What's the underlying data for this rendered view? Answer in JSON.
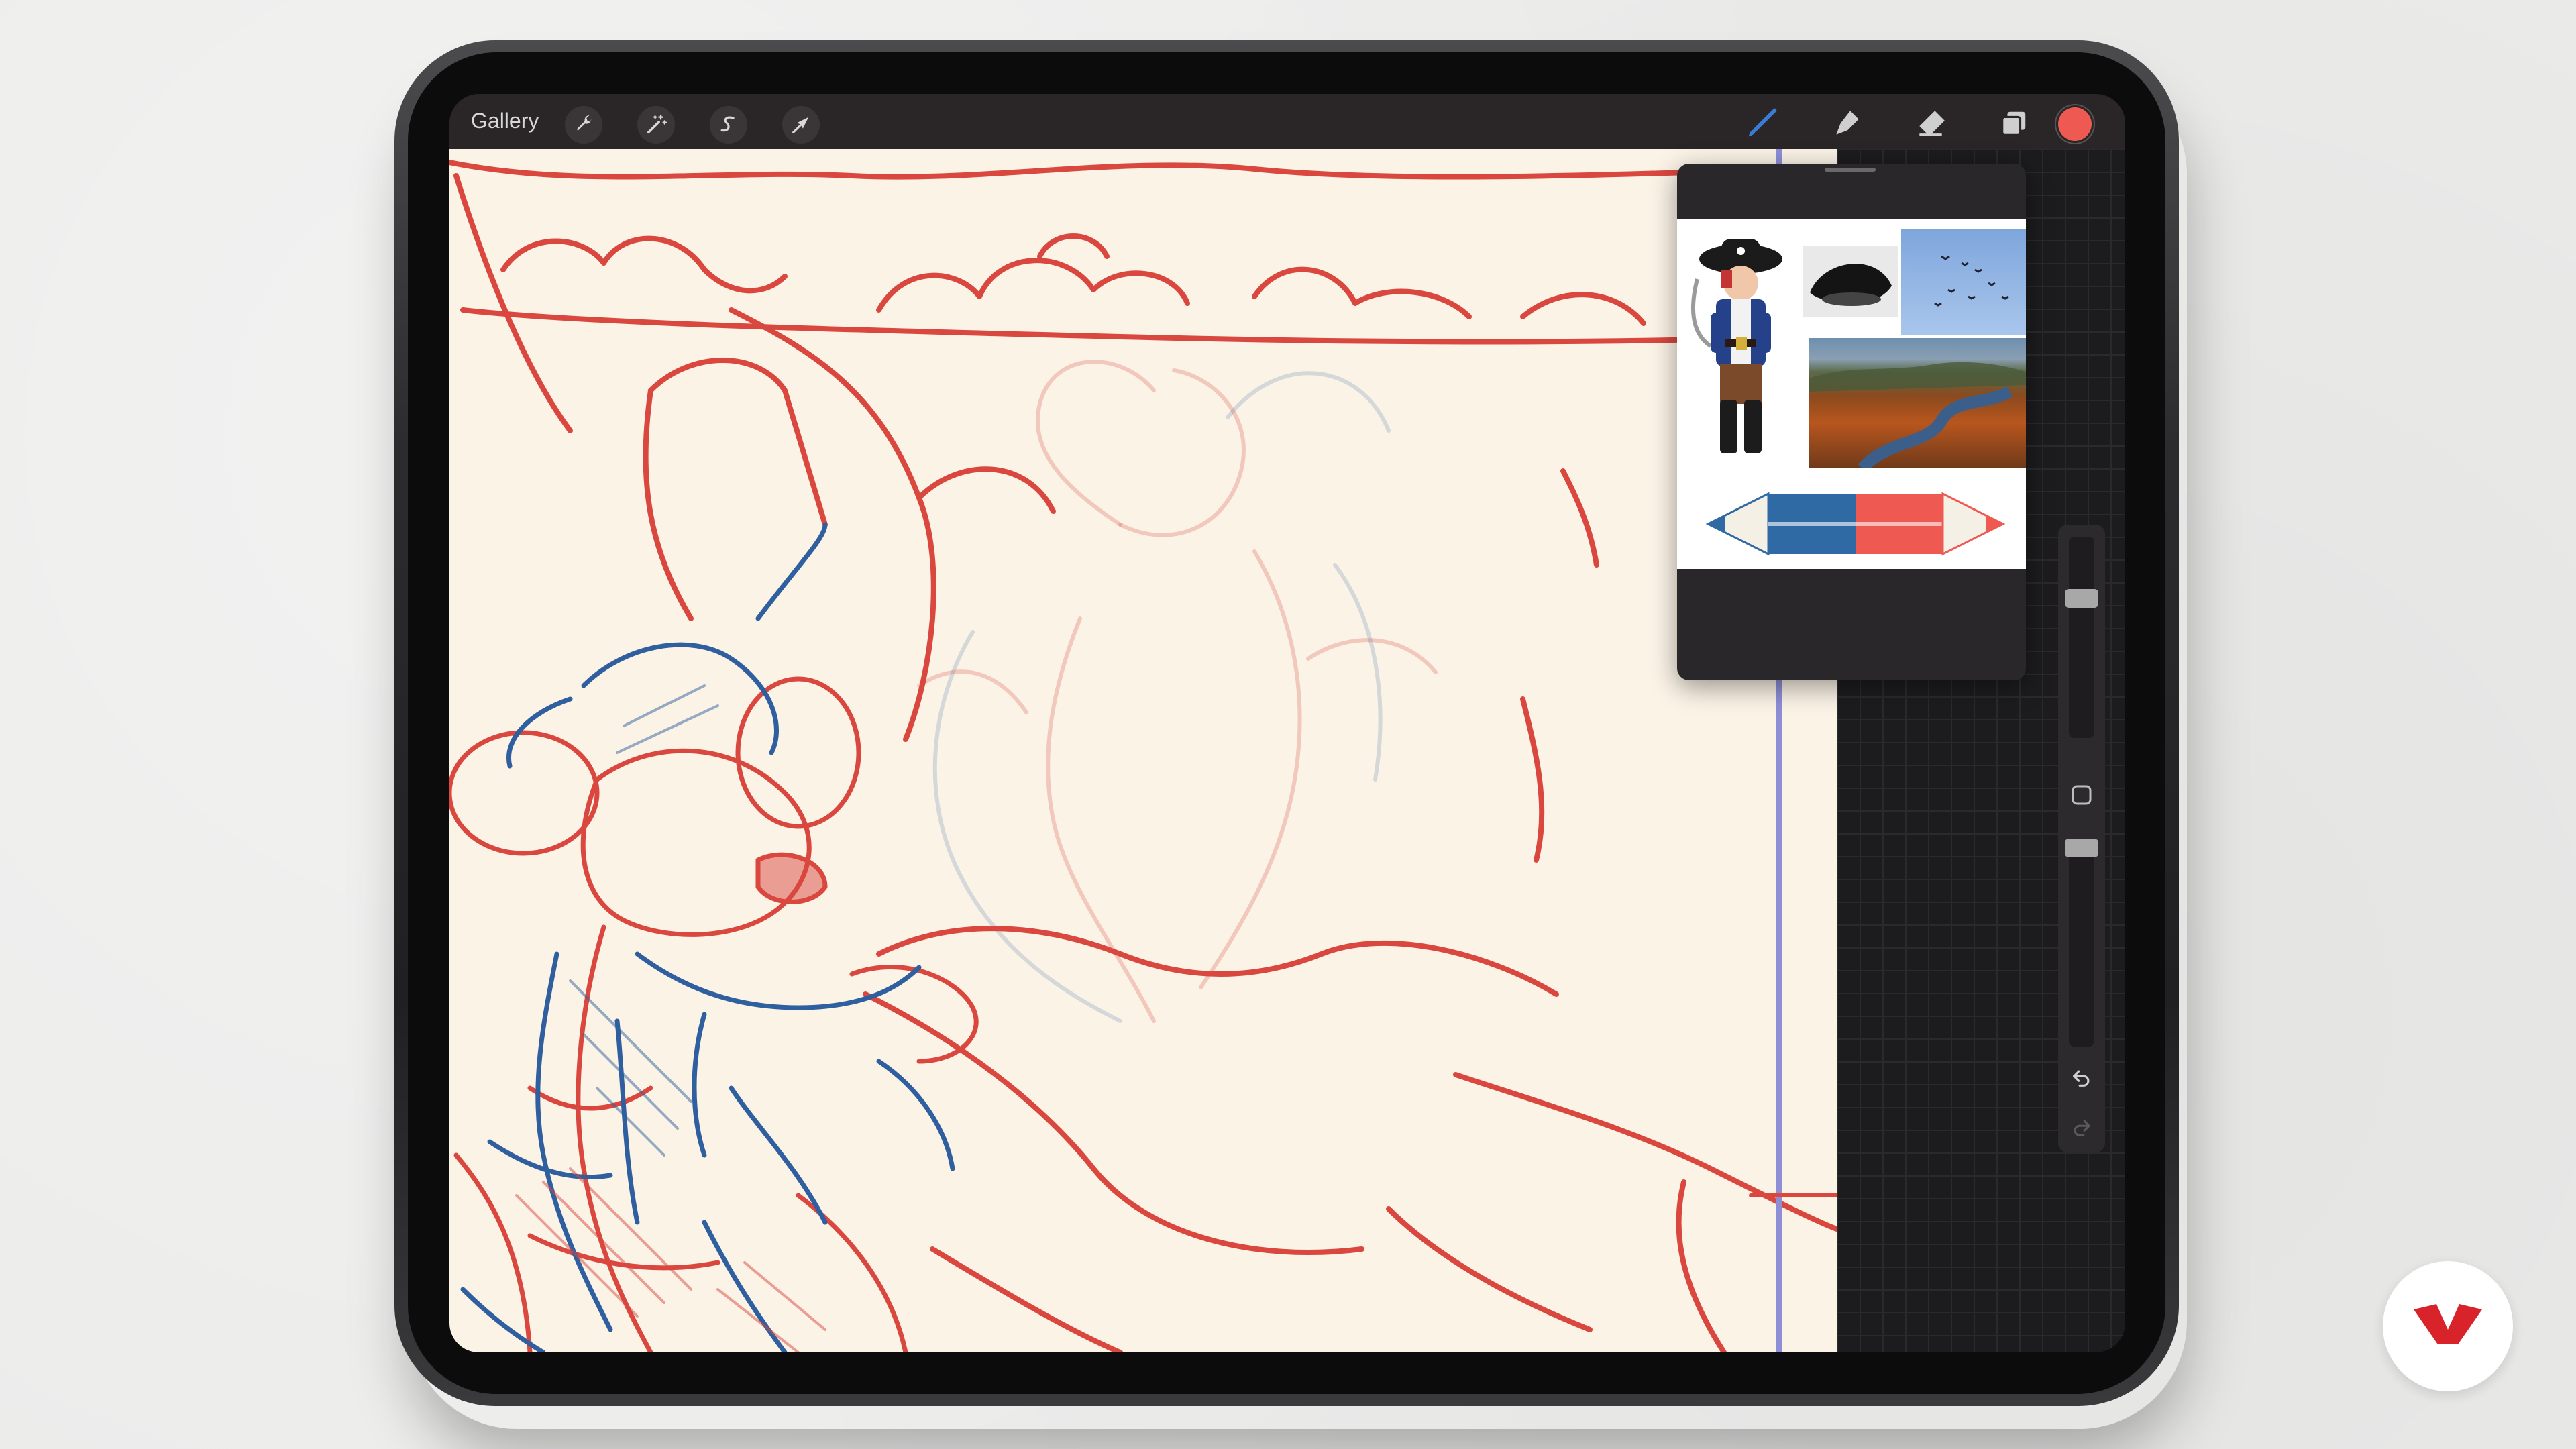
{
  "toolbar": {
    "gallery_label": "Gallery",
    "left_tools": [
      {
        "icon": "wrench-icon",
        "name": "actions"
      },
      {
        "icon": "magic-wand-icon",
        "name": "adjustments"
      },
      {
        "icon": "selection-icon",
        "name": "selection"
      },
      {
        "icon": "arrow-cursor-icon",
        "name": "transform"
      }
    ],
    "right_tools": [
      {
        "icon": "brush-icon",
        "name": "paint",
        "active": true
      },
      {
        "icon": "smudge-icon",
        "name": "smudge"
      },
      {
        "icon": "eraser-icon",
        "name": "eraser"
      },
      {
        "icon": "layers-icon",
        "name": "layers"
      }
    ],
    "current_color": "#ee5a52"
  },
  "reference_panel": {
    "images": [
      {
        "icon": "pirate-costume-image"
      },
      {
        "icon": "pirate-hat-image"
      },
      {
        "icon": "birds-sky-image"
      },
      {
        "icon": "autumn-river-valley-image"
      },
      {
        "icon": "two-color-pencil-image"
      }
    ]
  },
  "sidebar": {
    "brush_size_level": 0.72,
    "opacity_level": 0.93,
    "modify_button_icon": "square-modify-icon",
    "undo_icon": "undo-icon",
    "redo_icon": "redo-icon"
  },
  "colors": {
    "sketch_red": "#d9473f",
    "sketch_blue": "#2f5f9e",
    "paper": "#fbf3e6",
    "toolbar": "#2a2628",
    "accent_blue": "#3a7bd5"
  },
  "brand_logo": {
    "icon": "domestika-logo-icon"
  }
}
